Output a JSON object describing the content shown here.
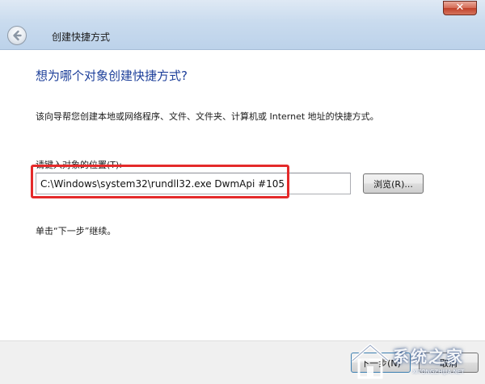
{
  "window": {
    "title": "创建快捷方式",
    "close_label": "✕"
  },
  "content": {
    "heading": "想为哪个对象创建快捷方式?",
    "description": "该向导帮您创建本地或网络程序、文件、文件夹、计算机或 Internet 地址的快捷方式。",
    "location_label": "请键入对象的位置(T):",
    "location_value": "C:\\Windows\\system32\\rundll32.exe DwmApi #105",
    "browse_label": "浏览(R)...",
    "continue_hint": "单击“下一步”继续。"
  },
  "buttons": {
    "next_label": "下一步(N)",
    "cancel_label": "取消"
  },
  "watermark": {
    "text": "系统之家",
    "url": "XITONGZHIJIA.NET"
  },
  "icons": {
    "back": "back-arrow-icon",
    "close": "close-icon",
    "watermark_logo": "house-logo-icon"
  },
  "colors": {
    "heading": "#1d3f9a",
    "highlight": "#e42a2a",
    "close": "#c0412a"
  }
}
